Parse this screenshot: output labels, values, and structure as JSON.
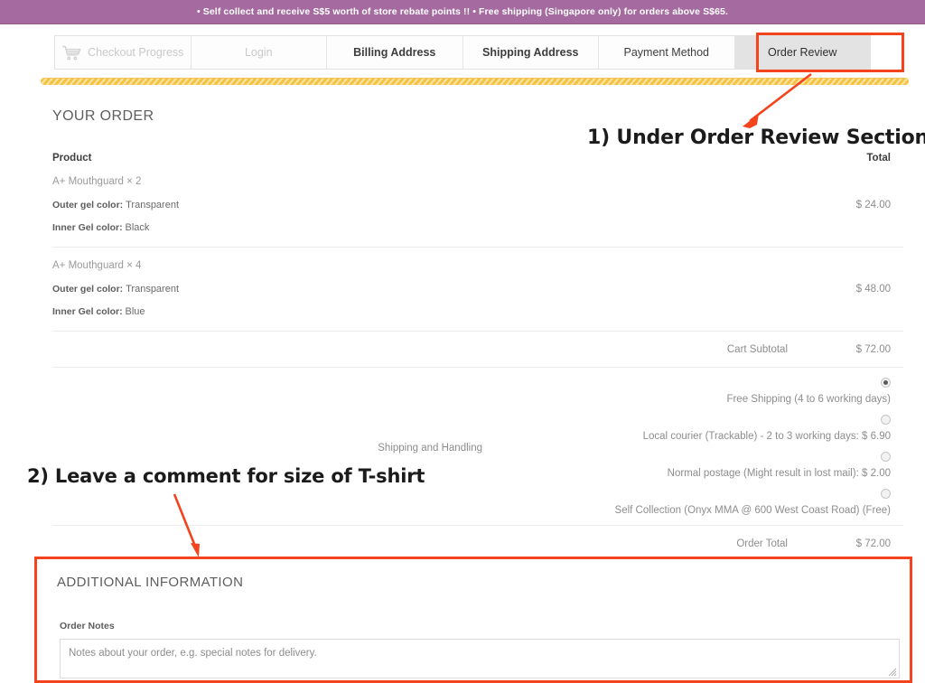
{
  "banner": {
    "text": "• Self collect and receive S$5 worth of store rebate points !! • Free shipping (Singapore only) for orders above S$65."
  },
  "checkout_tabs": [
    {
      "label": "Checkout Progress",
      "state": "muted",
      "icon": "shopping-cart-icon"
    },
    {
      "label": "Login",
      "state": "muted"
    },
    {
      "label": "Billing Address",
      "state": "bold"
    },
    {
      "label": "Shipping Address",
      "state": "bold"
    },
    {
      "label": "Payment Method",
      "state": "normal"
    },
    {
      "label": "Order Review",
      "state": "active"
    }
  ],
  "order": {
    "section_title": "YOUR ORDER",
    "col_product": "Product",
    "col_total": "Total",
    "items": [
      {
        "name": "A+ Mouthguard × 2",
        "outer_label": "Outer gel color:",
        "outer_value": "Transparent",
        "inner_label": "Inner Gel color:",
        "inner_value": "Black",
        "price": "$ 24.00"
      },
      {
        "name": "A+ Mouthguard × 4",
        "outer_label": "Outer gel color:",
        "outer_value": "Transparent",
        "inner_label": "Inner Gel color:",
        "inner_value": "Blue",
        "price": "$ 48.00"
      }
    ],
    "subtotal_label": "Cart Subtotal",
    "subtotal_value": "$ 72.00",
    "shipping_label": "Shipping and Handling",
    "shipping_options": [
      {
        "label": "Free Shipping (4 to 6 working days)",
        "selected": true
      },
      {
        "label": "Local courier (Trackable) - 2 to 3 working days: $ 6.90",
        "selected": false
      },
      {
        "label": "Normal postage (Might result in lost mail): $ 2.00",
        "selected": false
      },
      {
        "label": "Self Collection (Onyx MMA @ 600 West Coast Road) (Free)",
        "selected": false
      }
    ],
    "order_total_label": "Order Total",
    "order_total_value": "$ 72.00"
  },
  "additional_information": {
    "title": "ADDITIONAL INFORMATION",
    "notes_label": "Order Notes",
    "notes_placeholder": "Notes about your order, e.g. special notes for delivery.",
    "notes_value": ""
  },
  "annotations": [
    {
      "text": "1) Under Order Review Section"
    },
    {
      "text": "2) Leave a comment for size of T-shirt"
    }
  ],
  "colors": {
    "banner_purple": "#a56ba0",
    "annotation_red": "#f4441e",
    "progress_yellow": "#f5c342"
  }
}
